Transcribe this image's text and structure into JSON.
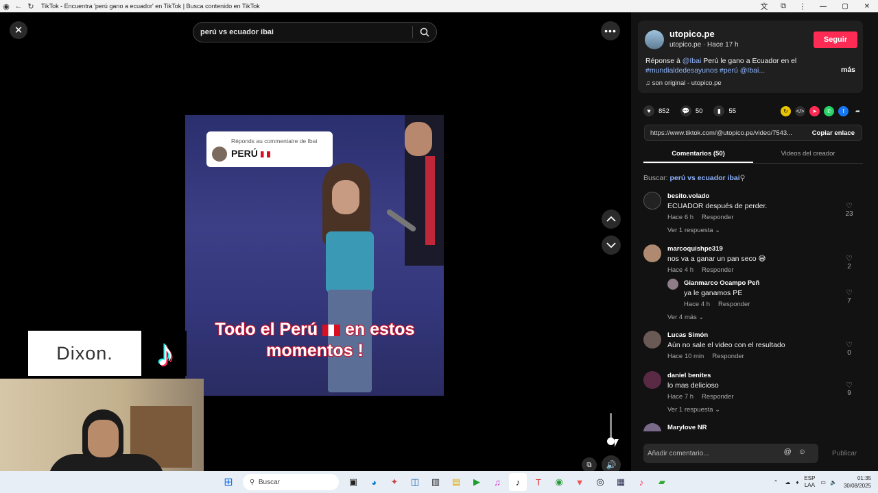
{
  "browser": {
    "title": "TikTok - Encuentra 'perú gano a ecuador' en TikTok | Busca contenido en TikTok"
  },
  "player": {
    "search_value": "perú vs ecuador ibai",
    "reply_card": {
      "title": "Réponds au commentaire de Ibai",
      "name": "PERÚ"
    },
    "caption_line1_a": "Todo el Perú",
    "caption_line1_b": "en estos",
    "caption_line2": "momentos !"
  },
  "overlay": {
    "brand_text": "Dixon.",
    "logo_glyph": "♪"
  },
  "post": {
    "username": "utopico.pe",
    "meta": "utopico.pe · Hace 17 h",
    "follow_label": "Seguir",
    "desc_prefix": "Réponse à ",
    "desc_mention": "@Ibai",
    "desc_text": " Perú le gano a Ecuador en el",
    "desc_tags": "#mundialdedesayunos #perú @Ibai...",
    "more_label": "más",
    "music": "son original - utopico.pe",
    "likes": "852",
    "comments": "50",
    "saves": "55",
    "link_url": "https://www.tiktok.com/@utopico.pe/video/7543...",
    "copy_label": "Copiar enlace"
  },
  "tabs": [
    {
      "label": "Comentarios (50)",
      "active": true
    },
    {
      "label": "Videos del creador",
      "active": false
    }
  ],
  "search_line": {
    "prefix": "Buscar: ",
    "query": "perú vs ecuador ibai"
  },
  "comments": [
    {
      "user": "besito.volado",
      "text": "ECUADOR después de perder.",
      "time": "Hace 6 h",
      "reply": "Responder",
      "likes": "23",
      "more": "Ver 1 respuesta"
    },
    {
      "user": "marcoquishpe319",
      "text": "nos va a ganar un pan seco 😅",
      "time": "Hace 4 h",
      "reply": "Responder",
      "likes": "2"
    },
    {
      "user": "Gianmarco Ocampo Peñ",
      "text": "ya le ganamos PE",
      "time": "Hace 4 h",
      "reply": "Responder",
      "likes": "7",
      "more": "Ver 4 más"
    },
    {
      "user": "Lucas Simón",
      "text": "Aún no sale el video con el resultado",
      "time": "Hace 10 min",
      "reply": "Responder",
      "likes": "0"
    },
    {
      "user": "daniel benites",
      "text": "lo mas delicioso",
      "time": "Hace 7 h",
      "reply": "Responder",
      "likes": "9",
      "more": "Ver 1 respuesta"
    },
    {
      "user": "Marylove NR",
      "text": "",
      "time": "",
      "reply": "",
      "likes": ""
    }
  ],
  "comment_box": {
    "placeholder": "Añadir comentario...",
    "publish_label": "Publicar"
  },
  "taskbar": {
    "search_label": "Buscar",
    "lang_1": "ESP",
    "lang_2": "LAA",
    "time": "01:35",
    "date": "30/08/2025"
  },
  "colors": {
    "accent": "#fe2c55",
    "link": "#8fb5ff",
    "panel": "#121212"
  }
}
